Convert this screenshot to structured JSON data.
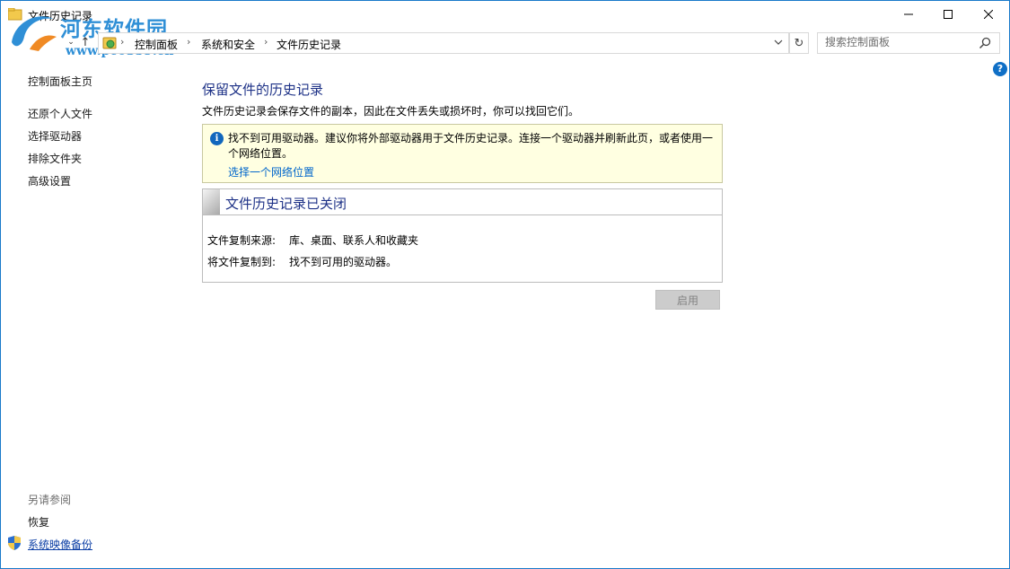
{
  "window": {
    "title": "文件历史记录"
  },
  "watermark": {
    "name": "河东软件园",
    "url": "www.pc0359.cn"
  },
  "address_bar": {
    "crumbs": [
      "控制面板",
      "系统和安全",
      "文件历史记录"
    ]
  },
  "search": {
    "placeholder": "搜索控制面板"
  },
  "sidebar": {
    "home": "控制面板主页",
    "items": [
      "还原个人文件",
      "选择驱动器",
      "排除文件夹",
      "高级设置"
    ],
    "see_also": "另请参阅",
    "see_also_items": [
      "恢复",
      "系统映像备份"
    ]
  },
  "main": {
    "title": "保留文件的历史记录",
    "description": "文件历史记录会保存文件的副本，因此在文件丢失或损坏时，你可以找回它们。",
    "info": {
      "message": "找不到可用驱动器。建议你将外部驱动器用于文件历史记录。连接一个驱动器并刷新此页，或者使用一个网络位置。",
      "link": "选择一个网络位置"
    },
    "status": {
      "title": "文件历史记录已关闭",
      "rows": [
        {
          "label": "文件复制来源:",
          "value": "库、桌面、联系人和收藏夹"
        },
        {
          "label": "将文件复制到:",
          "value": "找不到可用的驱动器。"
        }
      ]
    },
    "enable_button": "启用"
  },
  "colors": {
    "accent": "#1e3287",
    "link": "#0066cc",
    "info_bg": "#ffffe1",
    "window_border": "#1979ca"
  }
}
